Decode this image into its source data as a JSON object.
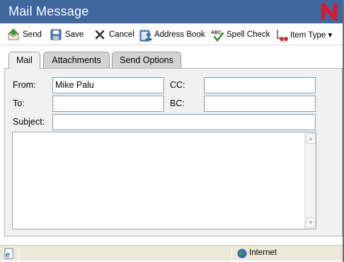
{
  "window": {
    "title": "Mail Message",
    "logo": "N",
    "accent": "#40669e",
    "logo_color": "#e0151f"
  },
  "toolbar": {
    "send_label": "Send",
    "save_label": "Save",
    "cancel_label": "Cancel",
    "address_book_label": "Address Book",
    "spell_check_label": "Spell Check",
    "spell_check_icon_text": "ABC",
    "item_type_label": "Item Type ▾"
  },
  "tabs": {
    "mail": "Mail",
    "attachments": "Attachments",
    "send_options": "Send Options",
    "active": "Mail"
  },
  "form": {
    "from_label": "From:",
    "from_value": "Mike Palu",
    "cc_label": "CC:",
    "cc_value": "",
    "to_label": "To:",
    "to_value": "",
    "bc_label": "BC:",
    "bc_value": "",
    "subject_label": "Subject:",
    "subject_value": "",
    "message_body": ""
  },
  "statusbar": {
    "zone": "Internet"
  }
}
